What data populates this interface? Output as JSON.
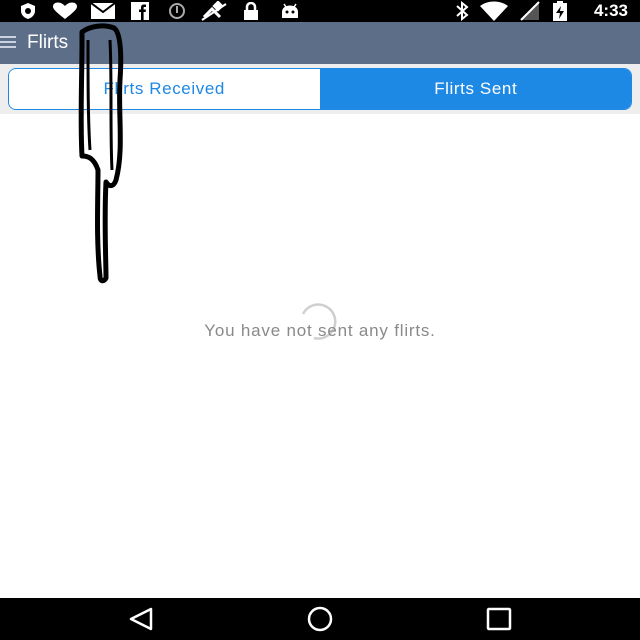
{
  "status_bar": {
    "time": "4:33",
    "icons": [
      "shield-icon",
      "heart-icon",
      "mail-icon",
      "facebook-icon",
      "sync-icon",
      "satellite-icon",
      "lock-icon",
      "android-icon",
      "bluetooth-icon",
      "wifi-icon",
      "no-signal-icon",
      "battery-charging-icon"
    ]
  },
  "app_bar": {
    "title": "Flirts",
    "menu_icon": "hamburger-menu-icon"
  },
  "tabs": [
    {
      "label": "Flirts Received",
      "active": false
    },
    {
      "label": "Flirts Sent",
      "active": true
    }
  ],
  "content": {
    "empty_message": "You have not sent any flirts.",
    "loading": true
  },
  "nav_bar": {
    "buttons": [
      "back-icon",
      "home-icon",
      "recents-icon"
    ]
  },
  "colors": {
    "app_bar": "#5c6e88",
    "accent": "#1e88e5",
    "status_bar": "#000000",
    "message_text": "#8a8a8a"
  }
}
